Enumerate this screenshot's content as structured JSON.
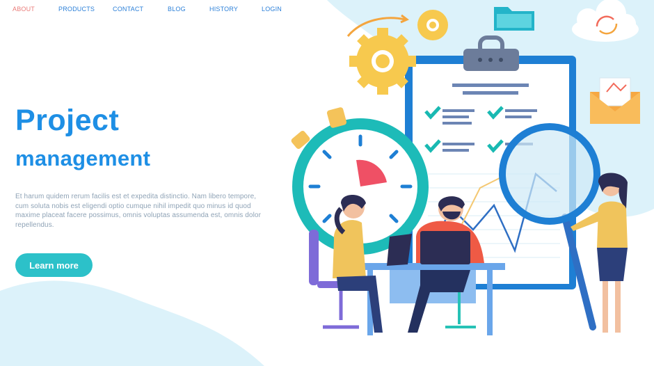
{
  "nav": {
    "items": [
      {
        "label": "ABOUT",
        "active": true
      },
      {
        "label": "PRODUCTS",
        "active": false
      },
      {
        "label": "CONTACT",
        "active": false
      },
      {
        "label": "BLOG",
        "active": false
      },
      {
        "label": "HISTORY",
        "active": false
      },
      {
        "label": "LOGIN",
        "active": false
      }
    ]
  },
  "hero": {
    "title": "Project",
    "subtitle": "management",
    "body": "Et harum quidem rerum facilis est et expedita distinctio. Nam libero tempore, cum soluta nobis est eligendi optio cumque nihil impedit quo minus id quod maxime placeat facere possimus, omnis voluptas assumenda est, omnis dolor repellendus.",
    "cta_label": "Learn more"
  },
  "colors": {
    "accent": "#1e8fe5",
    "active_nav": "#ea7b78",
    "button": "#2cc1c9",
    "background_blob": "#dff3fb"
  },
  "illustration": {
    "icons": [
      "gear-icon",
      "folder-icon",
      "cloud-sync-icon",
      "envelope-icon",
      "clipboard-checklist-icon",
      "stopwatch-icon",
      "magnifier-icon"
    ]
  }
}
